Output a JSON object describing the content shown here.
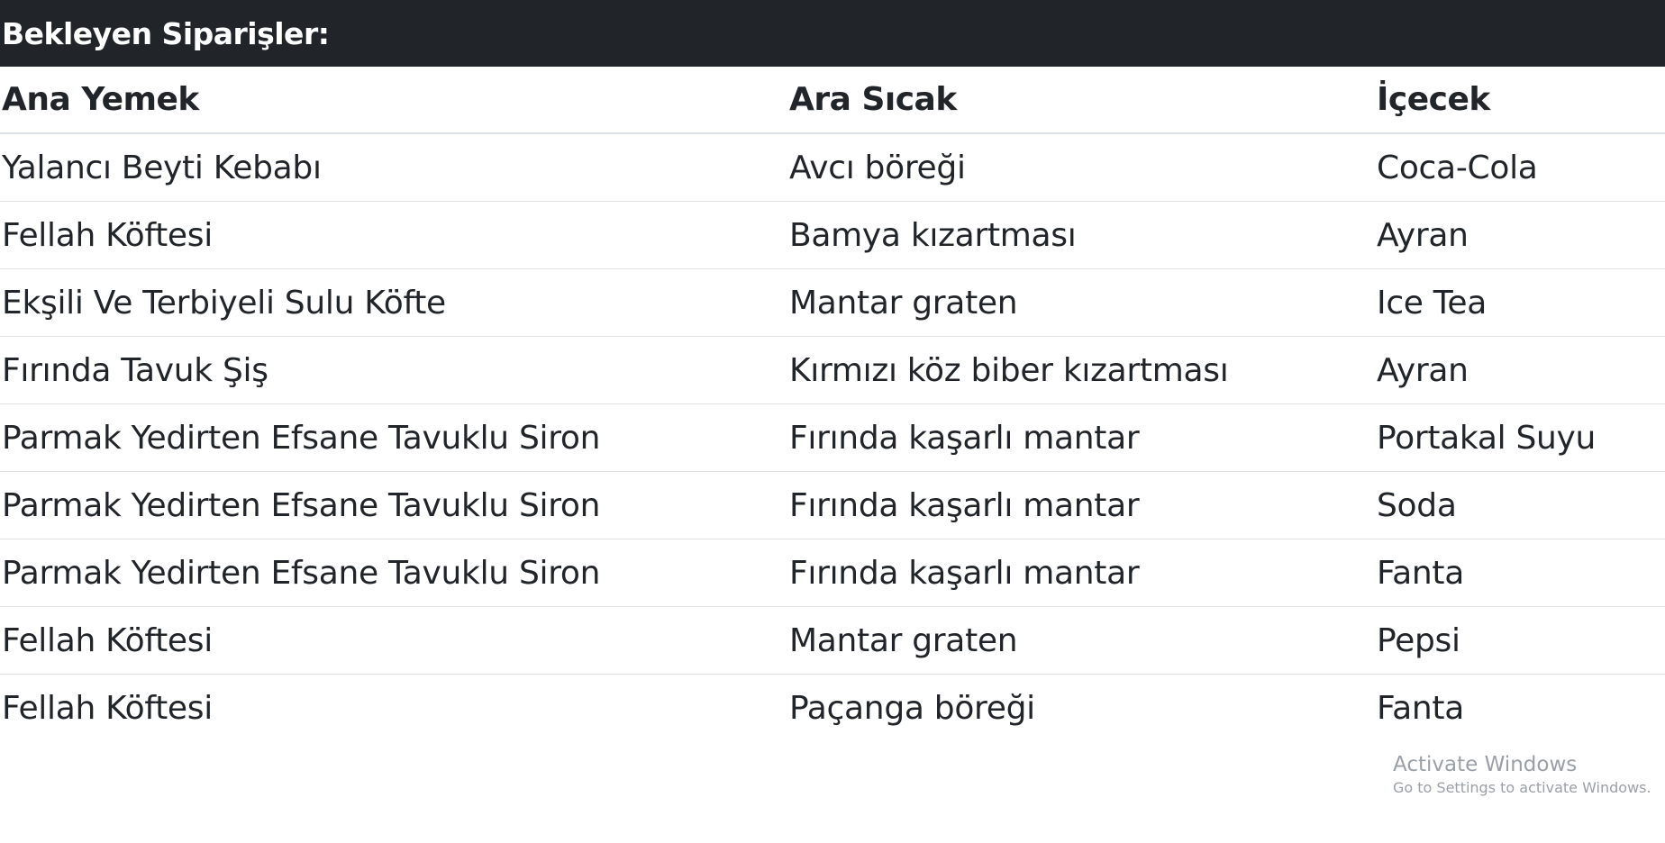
{
  "header": {
    "title": "Bekleyen Siparişler:"
  },
  "table": {
    "columns": [
      "Ana Yemek",
      "Ara Sıcak",
      "İçecek"
    ],
    "rows": [
      [
        "Yalancı Beyti Kebabı",
        "Avcı böreği",
        "Coca-Cola"
      ],
      [
        "Fellah Köftesi",
        "Bamya kızartması",
        "Ayran"
      ],
      [
        "Ekşili Ve Terbiyeli Sulu Köfte",
        "Mantar graten",
        "Ice Tea"
      ],
      [
        "Fırında Tavuk Şiş",
        "Kırmızı köz biber kızartması",
        "Ayran"
      ],
      [
        "Parmak Yedirten Efsane Tavuklu Siron",
        "Fırında kaşarlı mantar",
        "Portakal Suyu"
      ],
      [
        "Parmak Yedirten Efsane Tavuklu Siron",
        "Fırında kaşarlı mantar",
        "Soda"
      ],
      [
        "Parmak Yedirten Efsane Tavuklu Siron",
        "Fırında kaşarlı mantar",
        "Fanta"
      ],
      [
        "Fellah Köftesi",
        "Mantar graten",
        "Pepsi"
      ],
      [
        "Fellah Köftesi",
        "Paçanga böreği",
        "Fanta"
      ]
    ]
  },
  "watermark": {
    "title": "Activate Windows",
    "subtitle": "Go to Settings to activate Windows."
  },
  "colors": {
    "header_bg": "#212529",
    "header_text": "#ffffff",
    "text": "#212529",
    "border": "#dee2e6",
    "watermark": "#9aa0a6"
  }
}
